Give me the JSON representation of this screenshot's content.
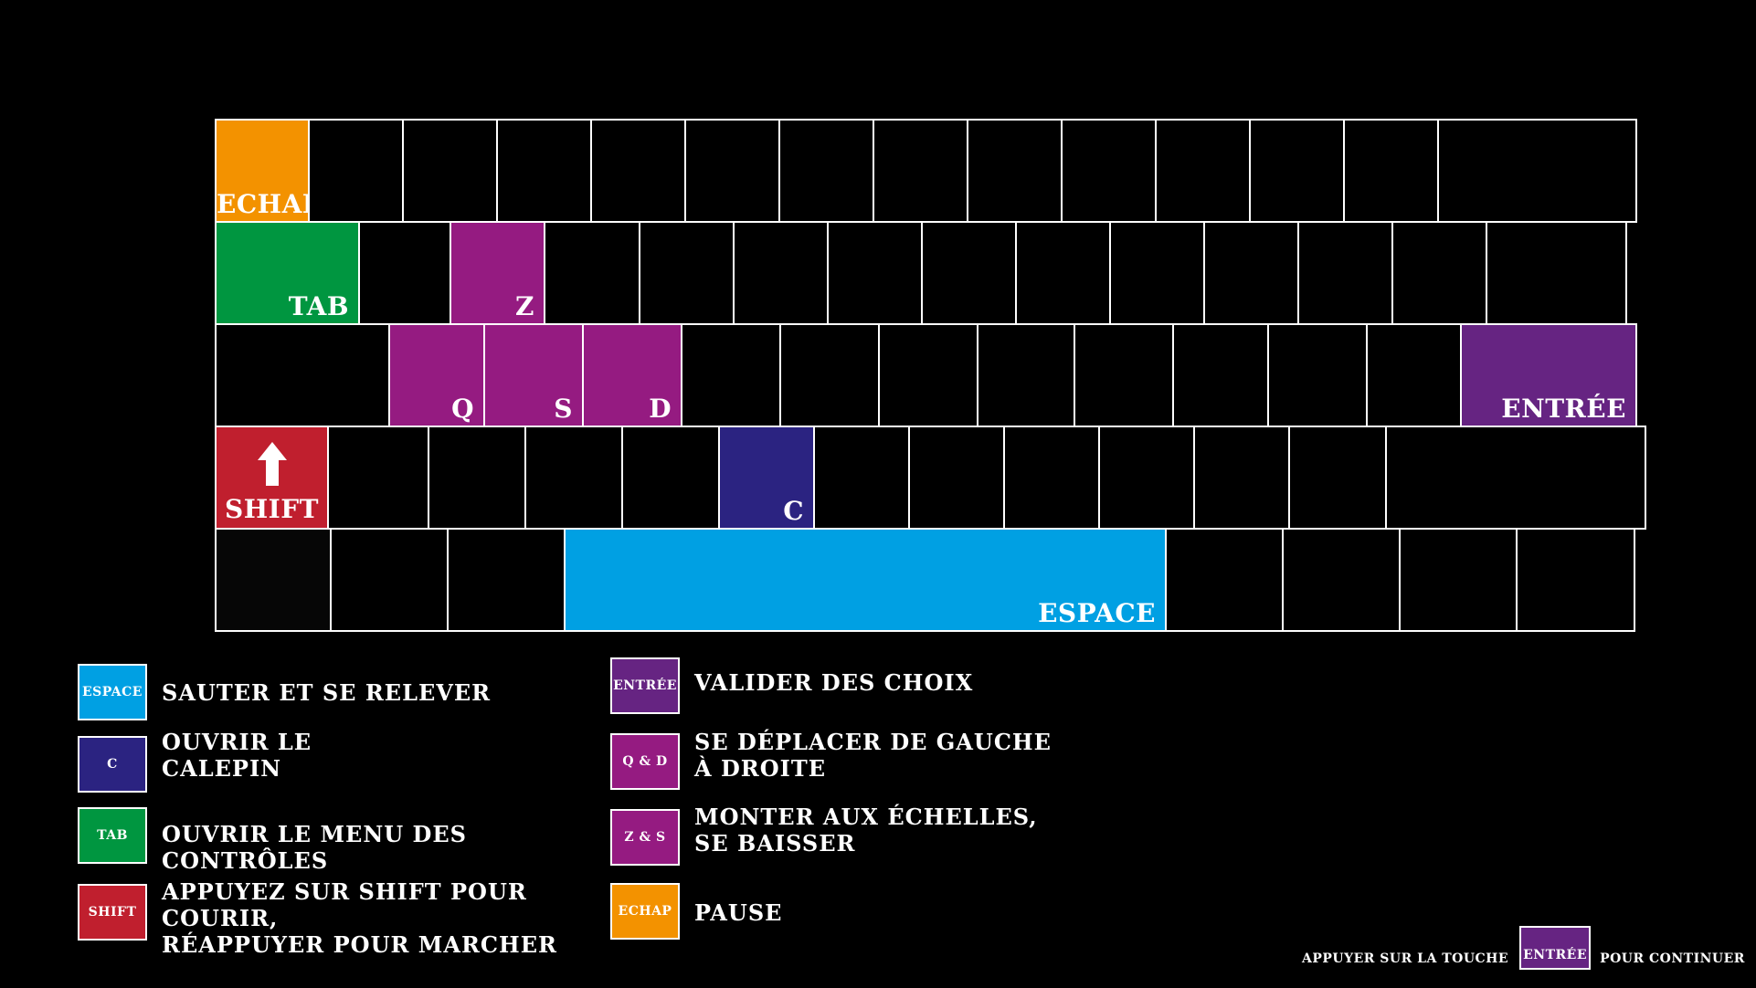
{
  "colors": {
    "espace": "#00a0e3",
    "c": "#2b2381",
    "tab": "#009640",
    "shift": "#c01f2e",
    "entree": "#662482",
    "move": "#951b81",
    "echap": "#f39200"
  },
  "keyboard": {
    "echap": "ECHAP",
    "tab": "TAB",
    "z": "Z",
    "q": "Q",
    "s": "S",
    "d": "D",
    "entree": "ENTRÉE",
    "shift": "SHIFT",
    "shift_icon": "arrow-up-icon",
    "c": "C",
    "espace": "ESPACE"
  },
  "legend": [
    {
      "key": "ESPACE",
      "color_key": "espace",
      "description": "Sauter et se relever"
    },
    {
      "key": "C",
      "color_key": "c",
      "description": "Ouvrir le\ncalepin"
    },
    {
      "key": "TAB",
      "color_key": "tab",
      "description": "Ouvrir le menu des contrôles"
    },
    {
      "key": "SHIFT",
      "color_key": "shift",
      "description": "Appuyez sur shift pour courir,\nréappuyer pour marcher"
    },
    {
      "key": "ENTRÉE",
      "color_key": "entree",
      "description": "Valider des choix"
    },
    {
      "key": "Q & D",
      "color_key": "move",
      "description": "Se déplacer de gauche\nà droite"
    },
    {
      "key": "Z & S",
      "color_key": "move",
      "description": "Monter aux échelles,\nse baisser"
    },
    {
      "key": "ECHAP",
      "color_key": "echap",
      "description": "Pause"
    }
  ],
  "footer": {
    "before": "Appuyer sur la touche",
    "key": "ENTRÉE",
    "after": "pour continuer"
  }
}
